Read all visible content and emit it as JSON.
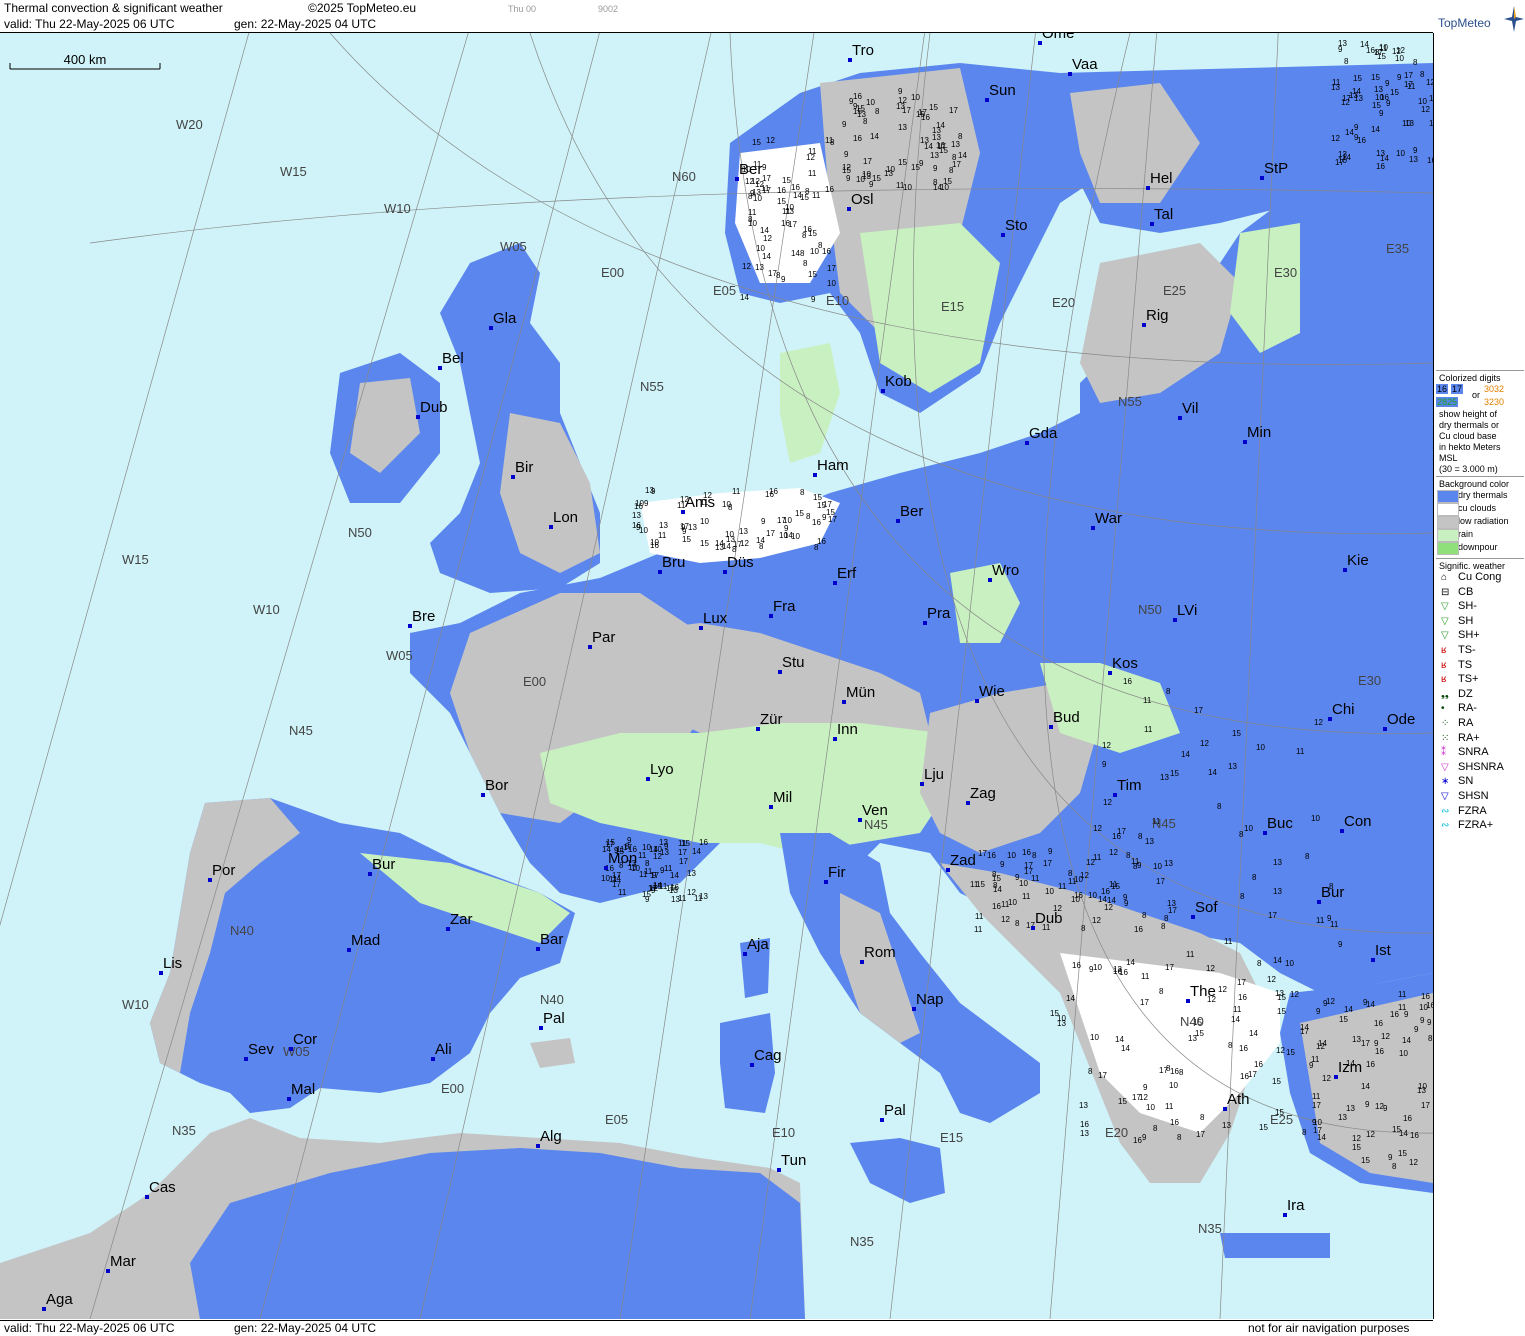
{
  "header": {
    "title": "Thermal convection & significant weather",
    "copyright": "©2025 TopMeteo.eu",
    "day_code": "Thu 00",
    "run_code": "9002",
    "valid": "valid:  Thu  22-May-2025  06 UTC",
    "generated": "gen: 22-May-2025 04 UTC"
  },
  "scale_bar": {
    "label": "400 km"
  },
  "footer": {
    "valid": "valid:  Thu  22-May-2025  06 UTC",
    "generated": "gen: 22-May-2025 04 UTC",
    "disclaimer": "not for air navigation purposes"
  },
  "logo": {
    "text": "TopMeteo"
  },
  "legend": {
    "digits_title": "Colorized digits",
    "digits_examples": [
      "16",
      "17",
      "or",
      "3032",
      "2825",
      "3230"
    ],
    "digits_text": [
      "show height of",
      "dry thermals or",
      "Cu cloud base",
      "in hekto Meters",
      "MSL",
      "(30 = 3.000 m)"
    ],
    "background_title": "Background color",
    "background": [
      {
        "label": "dry thermals",
        "color": "#5b86ee"
      },
      {
        "label": "cu clouds",
        "color": "#ffffff"
      },
      {
        "label": "low radiation",
        "color": "#c4c4c4"
      },
      {
        "label": "rain",
        "color": "#c8f0c0"
      },
      {
        "label": "downpour",
        "color": "#8fe07a"
      }
    ],
    "weather_title": "Signific. weather",
    "weather": [
      {
        "label": "Cu Cong",
        "icon": "cu-cong-icon",
        "glyph": "⌂",
        "color": "#000000"
      },
      {
        "label": "CB",
        "icon": "cb-icon",
        "glyph": "⊟",
        "color": "#000000"
      },
      {
        "label": "SH-",
        "icon": "shower-light-icon",
        "glyph": "▽",
        "color": "#2a9a2a"
      },
      {
        "label": "SH",
        "icon": "shower-icon",
        "glyph": "▽",
        "color": "#2a9a2a"
      },
      {
        "label": "SH+",
        "icon": "shower-heavy-icon",
        "glyph": "▽",
        "color": "#2a9a2a"
      },
      {
        "label": "TS-",
        "icon": "thunderstorm-light-icon",
        "glyph": "ʁ",
        "color": "#cc0000"
      },
      {
        "label": "TS",
        "icon": "thunderstorm-icon",
        "glyph": "ʁ",
        "color": "#cc0000"
      },
      {
        "label": "TS+",
        "icon": "thunderstorm-heavy-icon",
        "glyph": "ʁ",
        "color": "#cc0000"
      },
      {
        "label": "DZ",
        "icon": "drizzle-icon",
        "glyph": "❟❟",
        "color": "#004400"
      },
      {
        "label": "RA-",
        "icon": "rain-light-icon",
        "glyph": "•",
        "color": "#004400"
      },
      {
        "label": "RA",
        "icon": "rain-icon",
        "glyph": "⁘",
        "color": "#004400"
      },
      {
        "label": "RA+",
        "icon": "rain-heavy-icon",
        "glyph": "⁙",
        "color": "#004400"
      },
      {
        "label": "SNRA",
        "icon": "snow-rain-icon",
        "glyph": "⁑",
        "color": "#cc33cc"
      },
      {
        "label": "SHSNRA",
        "icon": "snow-rain-shower-icon",
        "glyph": "▽",
        "color": "#cc33cc"
      },
      {
        "label": "SN",
        "icon": "snow-icon",
        "glyph": "∗",
        "color": "#0000cc"
      },
      {
        "label": "SHSN",
        "icon": "snow-shower-icon",
        "glyph": "▽",
        "color": "#0000cc"
      },
      {
        "label": "FZRA",
        "icon": "freezing-rain-icon",
        "glyph": "∾",
        "color": "#00bbdd"
      },
      {
        "label": "FZRA+",
        "icon": "freezing-rain-heavy-icon",
        "glyph": "∾",
        "color": "#00bbdd"
      }
    ]
  },
  "grid_labels": [
    {
      "t": "W20"
    },
    {
      "t": "W15"
    },
    {
      "t": "W10"
    },
    {
      "t": "W05"
    },
    {
      "t": "E00"
    },
    {
      "t": "E05"
    },
    {
      "t": "E10"
    },
    {
      "t": "E15"
    },
    {
      "t": "E20"
    },
    {
      "t": "E25"
    },
    {
      "t": "E30"
    },
    {
      "t": "E35"
    },
    {
      "t": "N60"
    },
    {
      "t": "N55"
    },
    {
      "t": "N50"
    },
    {
      "t": "N45"
    },
    {
      "t": "N40"
    },
    {
      "t": "N35"
    },
    {
      "t": "W15"
    },
    {
      "t": "W10"
    },
    {
      "t": "W05"
    },
    {
      "t": "E00"
    },
    {
      "t": "E05"
    },
    {
      "t": "E10"
    },
    {
      "t": "E15"
    },
    {
      "t": "E20"
    },
    {
      "t": "E25"
    },
    {
      "t": "E30"
    },
    {
      "t": "N55"
    },
    {
      "t": "N50"
    },
    {
      "t": "N45"
    },
    {
      "t": "N40"
    },
    {
      "t": "N35"
    },
    {
      "t": "W10"
    },
    {
      "t": "W05"
    },
    {
      "t": "E00"
    },
    {
      "t": "N40"
    },
    {
      "t": "N35"
    },
    {
      "t": "N45"
    }
  ],
  "cities": [
    "Tro",
    "Ome",
    "Vaa",
    "Sun",
    "Ber",
    "Osl",
    "Hel",
    "StP",
    "Sto",
    "Tal",
    "Gla",
    "Rig",
    "Bel",
    "Kob",
    "Dub",
    "Gda",
    "Vil",
    "Min",
    "Bir",
    "Ham",
    "Ams",
    "Lon",
    "Ber",
    "War",
    "Kie",
    "Bru",
    "Düs",
    "Erf",
    "Wro",
    "Fra",
    "Bre",
    "Lux",
    "Pra",
    "Par",
    "LVi",
    "Stu",
    "Kos",
    "Wie",
    "Mün",
    "Chi",
    "Ode",
    "Bud",
    "Zür",
    "Inn",
    "Lju",
    "Lyo",
    "Tim",
    "Bor",
    "Zag",
    "Mil",
    "Ven",
    "Buc",
    "Con",
    "Fir",
    "Mon",
    "Zad",
    "Bur",
    "Por",
    "Zar",
    "Dub",
    "Sof",
    "Bur",
    "Rom",
    "Mad",
    "Bar",
    "Aja",
    "Ist",
    "Lis",
    "Nap",
    "The",
    "Pal",
    "Sev",
    "Cor",
    "Ali",
    "Cag",
    "Izm",
    "Mal",
    "Ath",
    "Pal",
    "Alg",
    "Tun",
    "Cas",
    "Ira",
    "Mar",
    "Aga"
  ]
}
